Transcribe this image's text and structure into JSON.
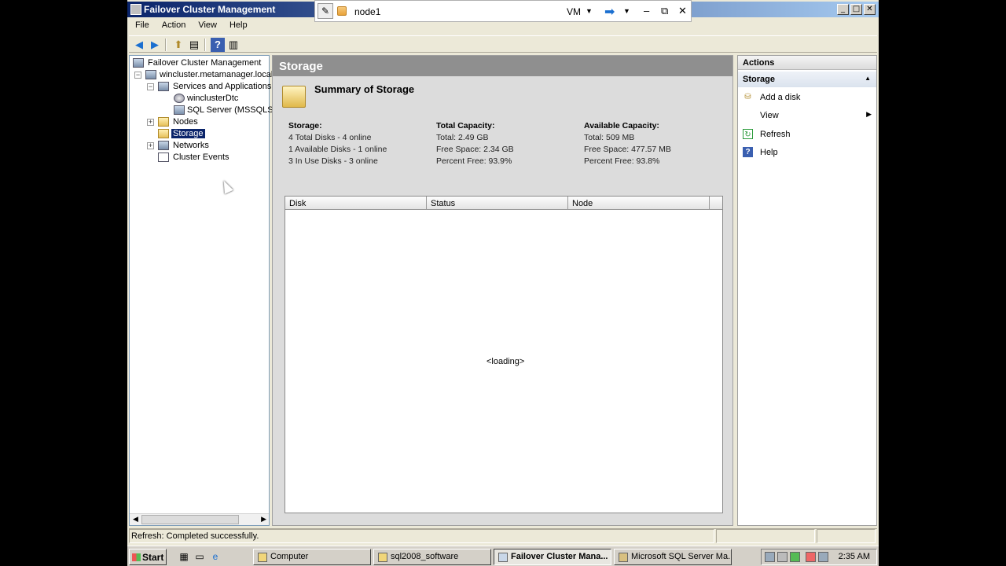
{
  "window": {
    "title": "Failover Cluster Management",
    "controls": {
      "minimize": "_",
      "maximize": "□",
      "close": "✕"
    }
  },
  "vm_bar": {
    "pin_icon": "pin-icon",
    "host_name": "node1",
    "vm_label": "VM",
    "minimize": "–",
    "restore": "⧉",
    "close": "✕"
  },
  "menu": [
    "File",
    "Action",
    "View",
    "Help"
  ],
  "toolbar": {
    "icons": [
      "back-icon",
      "forward-icon",
      "up-icon",
      "show-hide-tree-icon",
      "help-icon",
      "show-hide-action-pane-icon"
    ]
  },
  "tree": {
    "root": "Failover Cluster Management",
    "cluster": "wincluster.metamanager.local",
    "services": "Services and Applications",
    "dtc": "winclusterDtc",
    "sql": "SQL Server (MSSQLSE",
    "nodes": "Nodes",
    "storage": "Storage",
    "networks": "Networks",
    "events": "Cluster Events"
  },
  "center": {
    "header": "Storage",
    "summary_title": "Summary of Storage",
    "storage": {
      "heading": "Storage:",
      "lines": [
        "4 Total Disks - 4 online",
        "1 Available Disks - 1 online",
        "3 In Use Disks - 3 online"
      ]
    },
    "total_capacity": {
      "heading": "Total Capacity:",
      "lines": [
        "Total: 2.49 GB",
        "Free Space: 2.34 GB",
        "Percent Free: 93.9%"
      ]
    },
    "available_capacity": {
      "heading": "Available Capacity:",
      "lines": [
        "Total: 509 MB",
        "Free Space: 477.57 MB",
        "Percent Free: 93.8%"
      ]
    },
    "grid": {
      "columns": [
        "Disk",
        "Status",
        "Node"
      ],
      "loading_text": "<loading>"
    }
  },
  "actions": {
    "header": "Actions",
    "section": "Storage",
    "items": [
      {
        "label": "Add a disk",
        "icon": "add-disk-icon"
      },
      {
        "label": "View",
        "icon": "",
        "submenu": true
      },
      {
        "label": "Refresh",
        "icon": "refresh-icon"
      },
      {
        "label": "Help",
        "icon": "help-icon"
      }
    ]
  },
  "status": {
    "text": "Refresh:  Completed successfully."
  },
  "taskbar": {
    "start": "Start",
    "tasks": [
      "Computer",
      "sql2008_software",
      "Failover Cluster Mana...",
      "Microsoft SQL Server Ma..."
    ],
    "active_task": "Failover Cluster Mana...",
    "clock": "2:35 AM"
  }
}
